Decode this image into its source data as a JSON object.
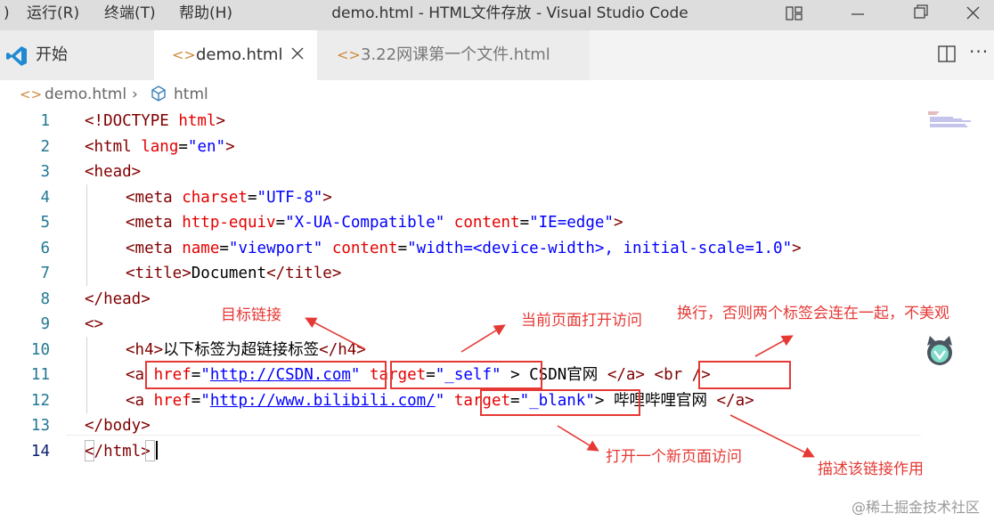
{
  "menu": {
    "run": "运行(R)",
    "terminal": "终端(T)",
    "help": "帮助(H)"
  },
  "window": {
    "title": "demo.html - HTML文件存放 - Visual Studio Code"
  },
  "tabs": [
    {
      "label": "开始"
    },
    {
      "label": "demo.html"
    },
    {
      "label": "3.22网课第一个文件.html"
    }
  ],
  "breadcrumb": {
    "file": "demo.html",
    "element": "html"
  },
  "code": {
    "line_numbers": [
      "1",
      "2",
      "3",
      "4",
      "5",
      "6",
      "7",
      "8",
      "9",
      "10",
      "11",
      "12",
      "13",
      "14"
    ],
    "l1": {
      "a": "<!DOCTYPE ",
      "b": "html",
      "c": ">"
    },
    "l2": {
      "a": "<html ",
      "b": "lang",
      "c": "=",
      "d": "\"en\"",
      "e": ">"
    },
    "l3": {
      "a": "<head>"
    },
    "l4": {
      "a": "<meta ",
      "b": "charset",
      "c": "=",
      "d": "\"UTF-8\"",
      "e": ">"
    },
    "l5": {
      "a": "<meta ",
      "b": "http-equiv",
      "c": "=",
      "d": "\"X-UA-Compatible\"",
      "e": " ",
      "f": "content",
      "g": "=",
      "h": "\"IE=edge\"",
      "i": ">"
    },
    "l6": {
      "a": "<meta ",
      "b": "name",
      "c": "=",
      "d": "\"viewport\"",
      "e": " ",
      "f": "content",
      "g": "=",
      "h": "\"width=<device-width>, initial-scale=1.0\"",
      "i": ">"
    },
    "l7": {
      "a": "<title>",
      "b": "Document",
      "c": "</title>"
    },
    "l8": {
      "a": "</head>"
    },
    "l9": {
      "a": "<>"
    },
    "l10": {
      "a": "<h4>",
      "b": "以下标签为超链接标签",
      "c": "</h4>"
    },
    "l11": {
      "a": "<a ",
      "b": "href",
      "c": "=",
      "d": "\"",
      "e": "http://CSDN.com",
      "f": "\"",
      "g": " ",
      "h": "target",
      "i": "=",
      "j": "\"_self\"",
      "k": " > CSDN官网 ",
      "l": "</a>",
      "m": " ",
      "n": "<br />"
    },
    "l12": {
      "a": "<a ",
      "b": "href",
      "c": "=",
      "d": "\"",
      "e": "http://www.bilibili.com/",
      "f": "\"",
      "g": " ",
      "h": "target",
      "i": "=",
      "j": "\"_blank\"",
      "k": "> 哔哩哔哩官网 ",
      "l": "</a>"
    },
    "l13": {
      "a": "</body>"
    },
    "l14": {
      "a": "</html",
      "b": ">"
    }
  },
  "annotations": {
    "target_link": "目标链接",
    "current_page": "当前页面打开访问",
    "line_break": "换行，否则两个标签会连在一起，不美观",
    "new_page": "打开一个新页面访问",
    "describe_link": "描述该链接作用"
  },
  "watermark": "@稀土掘金技术社区",
  "colors": {
    "annotation": "#e53935",
    "tag": "#800000",
    "attribute": "#e50000",
    "value": "#0000ff",
    "line_number": "#237893"
  }
}
